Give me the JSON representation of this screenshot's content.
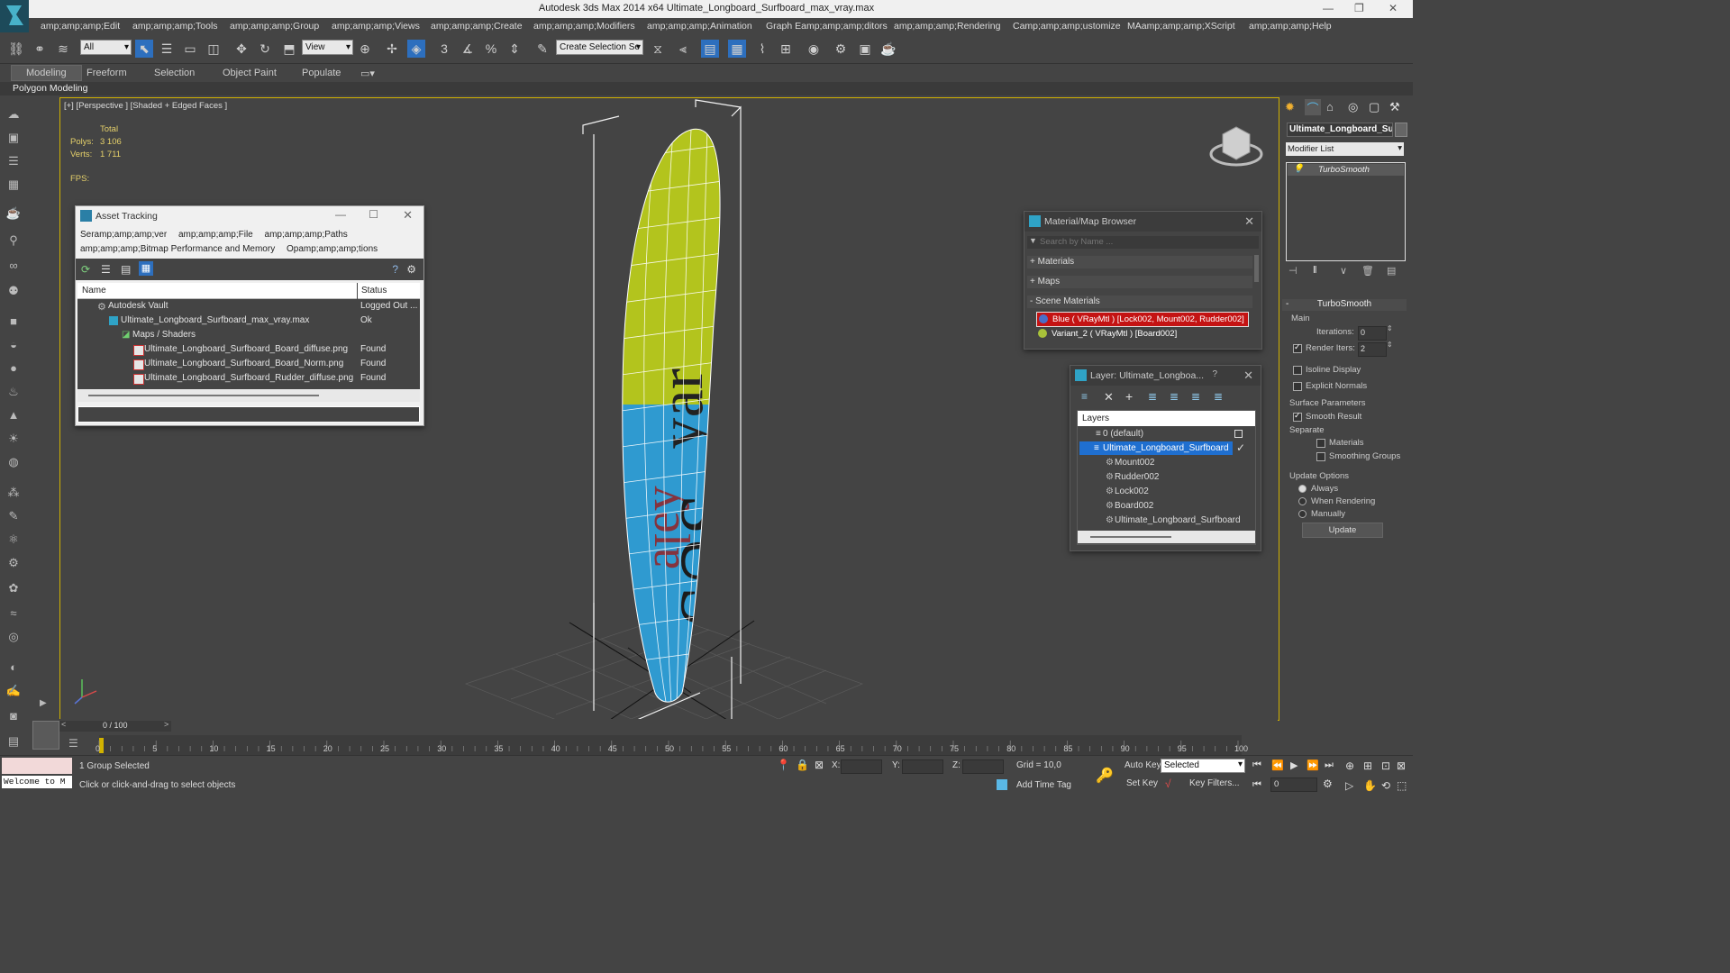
{
  "window": {
    "title": "Autodesk 3ds Max  2014 x64    Ultimate_Longboard_Surfboard_max_vray.max"
  },
  "menu": [
    "amp;amp;amp;Edit",
    "amp;amp;amp;Tools",
    "amp;amp;amp;Group",
    "amp;amp;amp;Views",
    "amp;amp;amp;Create",
    "amp;amp;amp;Modifiers",
    "amp;amp;amp;Animation",
    "Graph Eamp;amp;amp;ditors",
    "amp;amp;amp;Rendering",
    "Camp;amp;amp;ustomize",
    "MAamp;amp;amp;XScript",
    "amp;amp;amp;Help"
  ],
  "toolbar": {
    "filter_value": "All",
    "refcoord_value": "View",
    "selection_set_placeholder": "Create Selection Se"
  },
  "ribbon": {
    "tabs": [
      "Modeling",
      "Freeform",
      "Selection",
      "Object Paint",
      "Populate"
    ],
    "subtab": "Polygon Modeling"
  },
  "viewport": {
    "label": "[+] [Perspective ] [Shaded + Edged Faces ]",
    "stats_total": "Total",
    "polys_label": "Polys:",
    "polys_value": "3 106",
    "verts_label": "Verts:",
    "verts_value": "1 711",
    "fps_label": "FPS:"
  },
  "asset_tracking": {
    "title": "Asset Tracking",
    "menu_row1": [
      "Seramp;amp;amp;ver",
      "amp;amp;amp;File",
      "amp;amp;amp;Paths"
    ],
    "menu_row2": [
      "amp;amp;amp;Bitmap Performance and Memory",
      "Opamp;amp;amp;tions"
    ],
    "col_name": "Name",
    "col_status": "Status",
    "rows": [
      {
        "name": "Autodesk Vault",
        "status": "Logged Out ..."
      },
      {
        "name": "Ultimate_Longboard_Surfboard_max_vray.max",
        "status": "Ok"
      },
      {
        "name": "Maps / Shaders",
        "status": ""
      },
      {
        "name": "Ultimate_Longboard_Surfboard_Board_diffuse.png",
        "status": "Found"
      },
      {
        "name": "Ultimate_Longboard_Surfboard_Board_Norm.png",
        "status": "Found"
      },
      {
        "name": "Ultimate_Longboard_Surfboard_Rudder_diffuse.png",
        "status": "Found"
      }
    ]
  },
  "material_browser": {
    "title": "Material/Map Browser",
    "search_placeholder": "Search by Name ...",
    "sections": [
      "+ Materials",
      "+ Maps",
      "- Scene Materials"
    ],
    "materials": [
      "Blue  ( VRayMtl ) [Lock002, Mount002, Rudder002]",
      "Variant_2  ( VRayMtl ) [Board002]"
    ]
  },
  "layer_window": {
    "title": "Layer: Ultimate_Longboa...",
    "help": "?",
    "header": "Layers",
    "items": [
      "0 (default)",
      "Ultimate_Longboard_Surfboard",
      "Mount002",
      "Rudder002",
      "Lock002",
      "Board002",
      "Ultimate_Longboard_Surfboard"
    ]
  },
  "command_panel": {
    "object_name": "Ultimate_Longboard_Sur",
    "modifier_list": "Modifier List",
    "stack_item": "TurboSmooth",
    "rollout_title": "TurboSmooth",
    "main_label": "Main",
    "iterations_label": "Iterations:",
    "iterations_value": "0",
    "render_iters_label": "Render Iters:",
    "render_iters_value": "2",
    "isoline": "Isoline Display",
    "explicit_normals": "Explicit Normals",
    "surface_params": "Surface Parameters",
    "smooth_result": "Smooth Result",
    "separate": "Separate",
    "materials": "Materials",
    "smoothing_groups": "Smoothing Groups",
    "update_options": "Update Options",
    "always": "Always",
    "when_rendering": "When Rendering",
    "manually": "Manually",
    "update_button": "Update"
  },
  "timeline": {
    "frame_counter": "0 / 100",
    "ticks": [
      "0",
      "5",
      "10",
      "15",
      "20",
      "25",
      "30",
      "35",
      "40",
      "45",
      "50",
      "55",
      "60",
      "65",
      "70",
      "75",
      "80",
      "85",
      "90",
      "95",
      "100"
    ]
  },
  "status": {
    "welcome": "Welcome to M",
    "selection": "1 Group Selected",
    "prompt": "Click or click-and-drag to select objects",
    "x_label": "X:",
    "y_label": "Y:",
    "z_label": "Z:",
    "grid": "Grid = 10,0",
    "add_time_tag": "Add Time Tag",
    "auto_key": "Auto Key",
    "set_key": "Set Key",
    "selected_value": "Selected",
    "key_filters": "Key Filters...",
    "frame_value": "0"
  },
  "colors": {
    "accent": "#d1b200",
    "selection_blue": "#1f6fd0",
    "board_yellow": "#b3c41d",
    "board_blue": "#2f9ad0",
    "material_red": "#c41313"
  }
}
